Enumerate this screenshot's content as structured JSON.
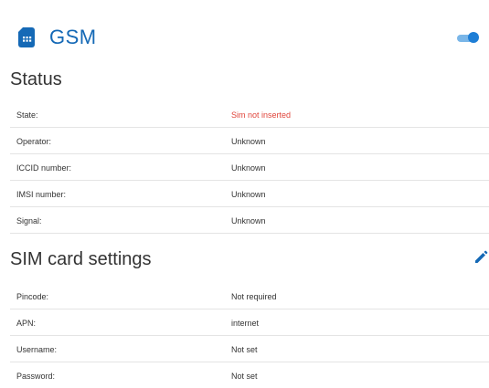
{
  "header": {
    "title": "GSM",
    "icon": "sim-card-icon",
    "toggle_state": "on",
    "accent_color": "#1569b6"
  },
  "status": {
    "title": "Status",
    "rows": [
      {
        "label": "State:",
        "value": "Sim not inserted",
        "status": "error"
      },
      {
        "label": "Operator:",
        "value": "Unknown"
      },
      {
        "label": "ICCID number:",
        "value": "Unknown"
      },
      {
        "label": "IMSI number:",
        "value": "Unknown"
      },
      {
        "label": "Signal:",
        "value": "Unknown"
      }
    ],
    "error_color": "#e0443a"
  },
  "sim_settings": {
    "title": "SIM card settings",
    "edit_icon": "pencil-icon",
    "rows": [
      {
        "label": "Pincode:",
        "value": "Not required"
      },
      {
        "label": "APN:",
        "value": "internet"
      },
      {
        "label": "Username:",
        "value": "Not set"
      },
      {
        "label": "Password:",
        "value": "Not set"
      }
    ]
  }
}
